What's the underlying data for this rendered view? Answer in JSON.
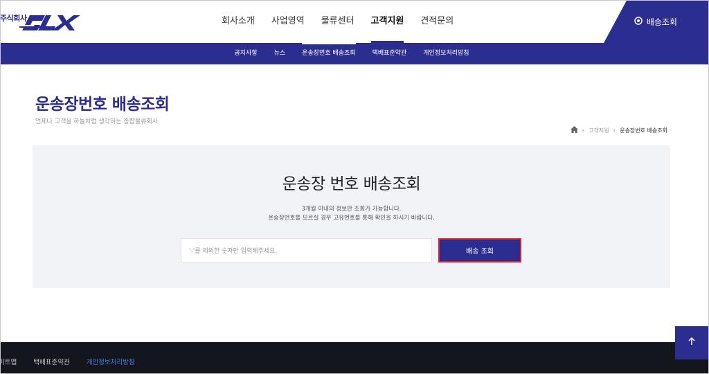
{
  "brand": {
    "company_prefix": "주식회사",
    "logo_text": "SLX",
    "color": "#2b2d8f"
  },
  "gnb": {
    "items": [
      {
        "label": "회사소개"
      },
      {
        "label": "사업영역"
      },
      {
        "label": "물류센터"
      },
      {
        "label": "고객지원",
        "active": true
      },
      {
        "label": "견적문의"
      }
    ],
    "tracking_button": "배송조회",
    "tracking_icon": "settings-circle-icon"
  },
  "subnav": {
    "items": [
      {
        "label": "공지사항"
      },
      {
        "label": "뉴스"
      },
      {
        "label": "운송장번호 배송조회",
        "active": true
      },
      {
        "label": "택배표준약관"
      },
      {
        "label": "개인정보처리방침"
      }
    ]
  },
  "page": {
    "title": "운송장번호 배송조회",
    "subtitle": "언제나 고객을 하늘처럼 생각하는 종합물류회사",
    "breadcrumb": {
      "home_icon": "home-icon",
      "level1": "고객지원",
      "current": "운송장번호 배송조회"
    }
  },
  "search": {
    "title": "운송장 번호 배송조회",
    "desc_line1": "3개월 이내의 정보만 조회가 가능합니다.",
    "desc_line2": "운송장번호를 모르실 경우 고유번호를 통해 확인을 하시기 바랍니다.",
    "placeholder": "'-'를 제외한 숫자만 입력해주세요.",
    "button_label": "배송 조회"
  },
  "footer": {
    "links": [
      "이트맵",
      "택배표준약관",
      "개인정보처리방침"
    ]
  },
  "top_button_icon": "arrow-up-icon"
}
